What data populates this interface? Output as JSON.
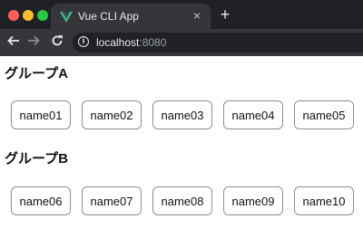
{
  "browser": {
    "tab_title": "Vue CLI App",
    "close_glyph": "×",
    "new_tab_glyph": "+",
    "url_host": "localhost",
    "url_port": ":8080",
    "icons": {
      "back": "arrow-left-icon",
      "forward": "arrow-right-icon",
      "reload": "reload-icon",
      "info": "info-icon",
      "favicon": "vue-logo-icon"
    }
  },
  "groups": [
    {
      "heading": "グループA",
      "items": [
        "name01",
        "name02",
        "name03",
        "name04",
        "name05"
      ]
    },
    {
      "heading": "グループB",
      "items": [
        "name06",
        "name07",
        "name08",
        "name09",
        "name10"
      ]
    }
  ],
  "colors": {
    "vue_green": "#41b883",
    "vue_dark": "#35495e"
  }
}
